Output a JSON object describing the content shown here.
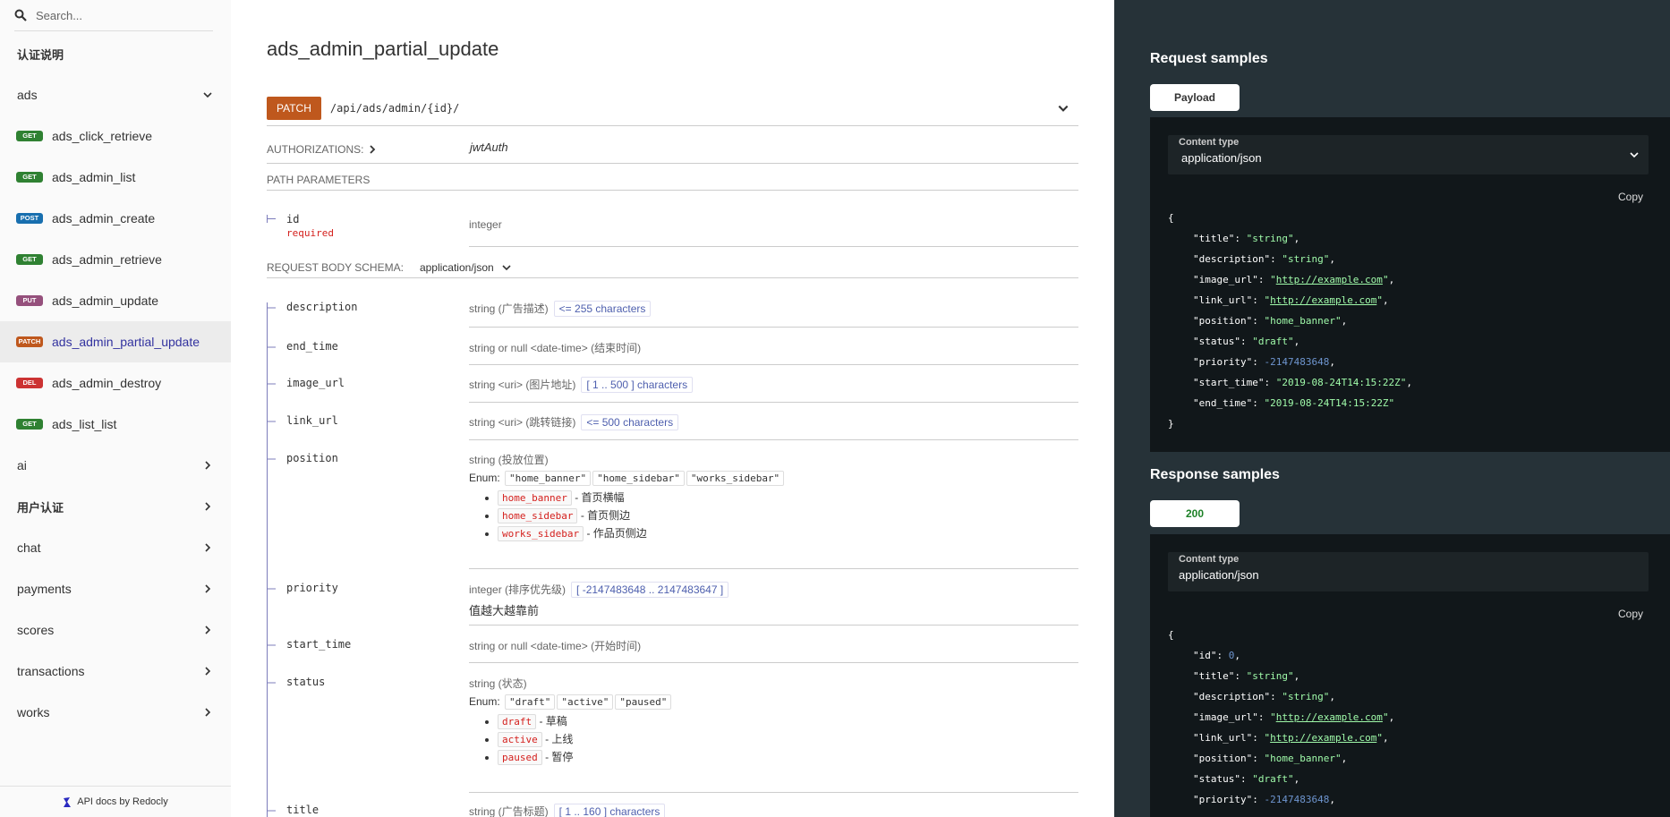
{
  "sidebar": {
    "search_placeholder": "Search...",
    "auth_section": "认证说明",
    "groups_top": [
      {
        "label": "ads",
        "expanded": true
      }
    ],
    "operations": [
      {
        "method": "GET",
        "label": "ads_click_retrieve"
      },
      {
        "method": "GET",
        "label": "ads_admin_list"
      },
      {
        "method": "POST",
        "label": "ads_admin_create"
      },
      {
        "method": "GET",
        "label": "ads_admin_retrieve"
      },
      {
        "method": "PUT",
        "label": "ads_admin_update"
      },
      {
        "method": "PATCH",
        "label": "ads_admin_partial_update",
        "active": true
      },
      {
        "method": "DEL",
        "label": "ads_admin_destroy"
      },
      {
        "method": "GET",
        "label": "ads_list_list"
      }
    ],
    "groups": [
      "ai",
      "用户认证",
      "chat",
      "payments",
      "scores",
      "transactions",
      "works"
    ],
    "footer": "API docs by Redocly"
  },
  "main": {
    "title": "ads_admin_partial_update",
    "method": "PATCH",
    "path": "/api/ads/admin/{id}/",
    "authorizations_label": "AUTHORIZATIONS:",
    "authorizations_value": "jwtAuth",
    "path_params_label": "PATH PARAMETERS",
    "path_params": [
      {
        "name": "id",
        "required": "required",
        "type": "integer"
      }
    ],
    "body_schema_label": "REQUEST BODY SCHEMA:",
    "body_schema_type": "application/json",
    "body_params": {
      "description": {
        "name": "description",
        "type": "string (广告描述)",
        "constraint": "<= 255 characters"
      },
      "end_time": {
        "name": "end_time",
        "type": "string or null <date-time> (结束时间)"
      },
      "image_url": {
        "name": "image_url",
        "type": "string <uri> (图片地址)",
        "constraint": "[ 1 .. 500 ] characters"
      },
      "link_url": {
        "name": "link_url",
        "type": "string <uri> (跳转链接)",
        "constraint": "<= 500 characters"
      },
      "position": {
        "name": "position",
        "type": "string (投放位置)",
        "enum_label": "Enum:",
        "enum": [
          "\"home_banner\"",
          "\"home_sidebar\"",
          "\"works_sidebar\""
        ],
        "items": [
          {
            "code": "home_banner",
            "text": "- 首页横幅"
          },
          {
            "code": "home_sidebar",
            "text": "- 首页侧边"
          },
          {
            "code": "works_sidebar",
            "text": "- 作品页侧边"
          }
        ]
      },
      "priority": {
        "name": "priority",
        "type": "integer (排序优先级)",
        "constraint": "[ -2147483648 .. 2147483647 ]",
        "description": "值越大越靠前"
      },
      "start_time": {
        "name": "start_time",
        "type": "string or null <date-time> (开始时间)"
      },
      "status": {
        "name": "status",
        "type": "string (状态)",
        "enum_label": "Enum:",
        "enum": [
          "\"draft\"",
          "\"active\"",
          "\"paused\""
        ],
        "items": [
          {
            "code": "draft",
            "text": "- 草稿"
          },
          {
            "code": "active",
            "text": "- 上线"
          },
          {
            "code": "paused",
            "text": "- 暂停"
          }
        ]
      },
      "title": {
        "name": "title",
        "type": "string (广告标题)",
        "constraint": "[ 1 .. 160 ] characters"
      }
    }
  },
  "right": {
    "request_title": "Request samples",
    "request_tab": "Payload",
    "content_type_label": "Content type",
    "content_type": "application/json",
    "copy": "Copy",
    "response_title": "Response samples",
    "response_tab": "200",
    "request_json": {
      "open": "{",
      "close": "}",
      "title": "\"string\"",
      "description": "\"string\"",
      "image_url": "http://example.com",
      "link_url": "http://example.com",
      "position": "\"home_banner\"",
      "status": "\"draft\"",
      "priority": "-2147483648",
      "start_time": "\"2019-08-24T14:15:22Z\"",
      "end_time": "\"2019-08-24T14:15:22Z\""
    },
    "response_json": {
      "open": "{",
      "id": "0",
      "title": "\"string\"",
      "description": "\"string\"",
      "image_url": "http://example.com",
      "link_url": "http://example.com",
      "position": "\"home_banner\"",
      "status": "\"draft\"",
      "priority": "-2147483648"
    }
  },
  "colors": {
    "get": "#2f8132",
    "post": "#186faf",
    "put": "#95507c",
    "patch": "#bf581d",
    "del": "#cc3333",
    "panel": "#263238"
  }
}
